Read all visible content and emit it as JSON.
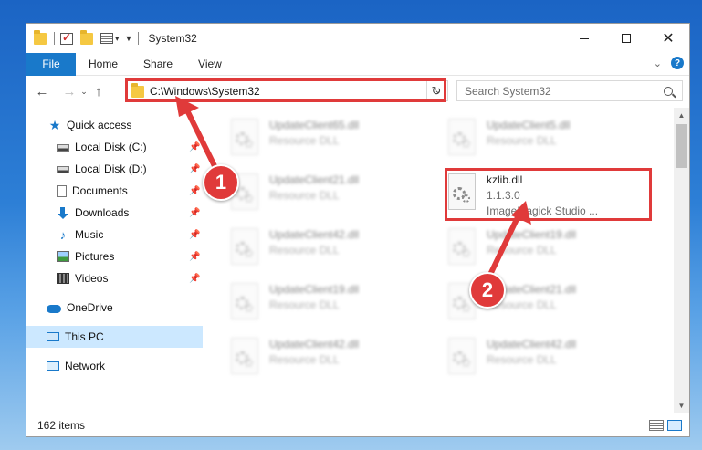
{
  "window": {
    "title": "System32",
    "buttons": {
      "minimize": "",
      "maximize": "",
      "close": "✕"
    }
  },
  "ribbon": {
    "tabs": [
      {
        "label": "File"
      },
      {
        "label": "Home"
      },
      {
        "label": "Share"
      },
      {
        "label": "View"
      }
    ],
    "help": "?"
  },
  "nav": {
    "back": "←",
    "forward": "→",
    "recent": "⌄",
    "up": "↑",
    "address": "C:\\Windows\\System32",
    "search_placeholder": "Search System32"
  },
  "sidebar": {
    "items": [
      {
        "label": "Quick access",
        "icon": "star-icon"
      },
      {
        "label": "Local Disk (C:)",
        "icon": "drive-icon",
        "pinned": true
      },
      {
        "label": "Local Disk (D:)",
        "icon": "drive-icon",
        "pinned": true
      },
      {
        "label": "Documents",
        "icon": "documents-icon",
        "pinned": true
      },
      {
        "label": "Downloads",
        "icon": "downloads-icon",
        "pinned": true
      },
      {
        "label": "Music",
        "icon": "music-icon",
        "pinned": true
      },
      {
        "label": "Pictures",
        "icon": "pictures-icon",
        "pinned": true
      },
      {
        "label": "Videos",
        "icon": "videos-icon",
        "pinned": true
      },
      {
        "label": "OneDrive",
        "icon": "cloud-icon"
      },
      {
        "label": "This PC",
        "icon": "computer-icon",
        "selected": true
      },
      {
        "label": "Network",
        "icon": "network-icon"
      }
    ]
  },
  "files": [
    {
      "name": "UpdateClient65.dll",
      "sub": "Resource DLL",
      "blurred": true
    },
    {
      "name": "UpdateClient5.dll",
      "sub": "Resource DLL",
      "blurred": true
    },
    {
      "name": "UpdateClient21.dll",
      "sub": "Resource DLL",
      "blurred": true
    },
    {
      "name": "kzlib.dll",
      "version": "1.1.3.0",
      "sub": "ImageMagick Studio ...",
      "blurred": false
    },
    {
      "name": "UpdateClient42.dll",
      "sub": "Resource DLL",
      "blurred": true
    },
    {
      "name": "UpdateClient19.dll",
      "sub": "Resource DLL",
      "blurred": true
    },
    {
      "name": "UpdateClient19.dll",
      "sub": "Resource DLL",
      "blurred": true
    },
    {
      "name": "UpdateClient21.dll",
      "sub": "Resource DLL",
      "blurred": true
    },
    {
      "name": "UpdateClient42.dll",
      "sub": "Resource DLL",
      "blurred": true
    },
    {
      "name": "UpdateClient42.dll",
      "sub": "Resource DLL",
      "blurred": true
    }
  ],
  "status": {
    "item_count": "162 items"
  },
  "annotations": {
    "step1": "1",
    "step2": "2",
    "color": "#e03a3a"
  },
  "colors": {
    "accent": "#1979ca",
    "selection": "#cce8ff",
    "highlight": "#e03a3a"
  }
}
